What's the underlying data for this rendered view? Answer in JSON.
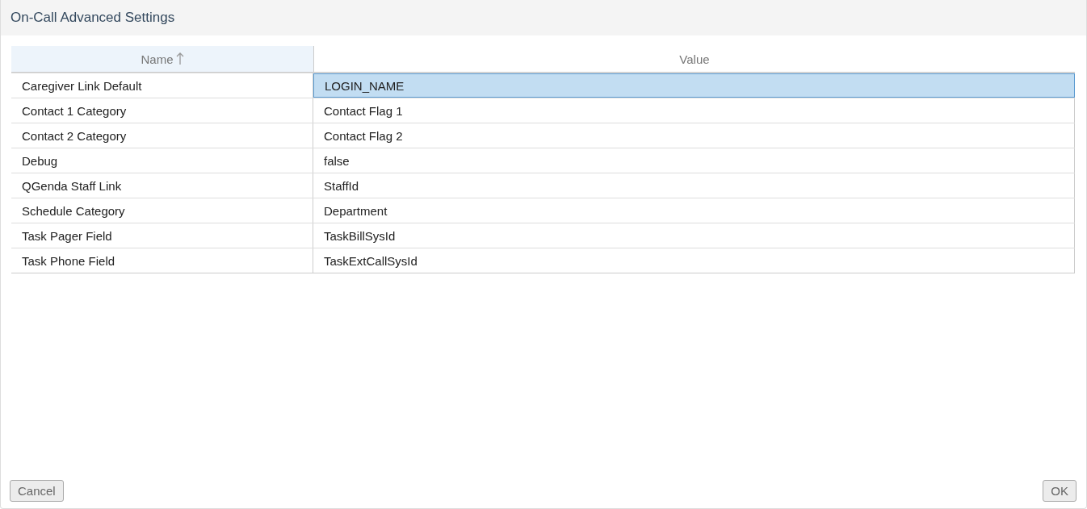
{
  "window": {
    "title": "On-Call Advanced Settings"
  },
  "table": {
    "columns": [
      {
        "label": "Name",
        "sorted": true
      },
      {
        "label": "Value",
        "sorted": false
      }
    ],
    "rows": [
      {
        "name": "Caregiver Link Default",
        "value": "LOGIN_NAME",
        "selected": true
      },
      {
        "name": "Contact 1 Category",
        "value": "Contact Flag 1",
        "selected": false
      },
      {
        "name": "Contact 2 Category",
        "value": "Contact Flag 2",
        "selected": false
      },
      {
        "name": "Debug",
        "value": "false",
        "selected": false
      },
      {
        "name": "QGenda Staff Link",
        "value": "StaffId",
        "selected": false
      },
      {
        "name": "Schedule Category",
        "value": "Department",
        "selected": false
      },
      {
        "name": "Task Pager Field",
        "value": "TaskBillSysId",
        "selected": false
      },
      {
        "name": "Task Phone Field",
        "value": "TaskExtCallSysId",
        "selected": false
      }
    ]
  },
  "buttons": [
    {
      "label": "Cancel"
    },
    {
      "label": "OK"
    }
  ]
}
